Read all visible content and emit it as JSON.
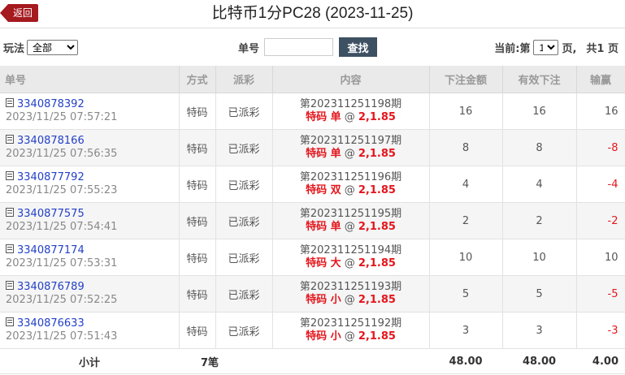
{
  "header": {
    "back_label": "返回",
    "title": "比特币1分PC28 (2023-11-25)"
  },
  "filters": {
    "play_label": "玩法",
    "play_value": "全部",
    "order_label": "单号",
    "order_value": "",
    "search_label": "查找",
    "current_label": "当前:第",
    "page_value": "1",
    "page_unit": "页,",
    "total_pages": "共1 页"
  },
  "table": {
    "columns": [
      "单号",
      "方式",
      "派彩",
      "内容",
      "下注金额",
      "有效下注",
      "输赢"
    ],
    "rows": [
      {
        "order_id": "3340878392",
        "time": "2023/11/25 07:57:21",
        "method": "特码",
        "status": "已派彩",
        "issue": "第202311251198期",
        "bet": "特码 单",
        "odds": "2,1.85",
        "amount": "16",
        "valid": "16",
        "winloss": "16"
      },
      {
        "order_id": "3340878166",
        "time": "2023/11/25 07:56:35",
        "method": "特码",
        "status": "已派彩",
        "issue": "第202311251197期",
        "bet": "特码 单",
        "odds": "2,1.85",
        "amount": "8",
        "valid": "8",
        "winloss": "-8"
      },
      {
        "order_id": "3340877792",
        "time": "2023/11/25 07:55:23",
        "method": "特码",
        "status": "已派彩",
        "issue": "第202311251196期",
        "bet": "特码 双",
        "odds": "2,1.85",
        "amount": "4",
        "valid": "4",
        "winloss": "-4"
      },
      {
        "order_id": "3340877575",
        "time": "2023/11/25 07:54:41",
        "method": "特码",
        "status": "已派彩",
        "issue": "第202311251195期",
        "bet": "特码 单",
        "odds": "2,1.85",
        "amount": "2",
        "valid": "2",
        "winloss": "-2"
      },
      {
        "order_id": "3340877174",
        "time": "2023/11/25 07:53:31",
        "method": "特码",
        "status": "已派彩",
        "issue": "第202311251194期",
        "bet": "特码 大",
        "odds": "2,1.85",
        "amount": "10",
        "valid": "10",
        "winloss": "10"
      },
      {
        "order_id": "3340876789",
        "time": "2023/11/25 07:52:25",
        "method": "特码",
        "status": "已派彩",
        "issue": "第202311251193期",
        "bet": "特码 小",
        "odds": "2,1.85",
        "amount": "5",
        "valid": "5",
        "winloss": "-5"
      },
      {
        "order_id": "3340876633",
        "time": "2023/11/25 07:51:43",
        "method": "特码",
        "status": "已派彩",
        "issue": "第202311251192期",
        "bet": "特码 小",
        "odds": "2,1.85",
        "amount": "3",
        "valid": "3",
        "winloss": "-3"
      }
    ],
    "summary": {
      "label": "小计",
      "count": "7笔",
      "amount": "48.00",
      "valid": "48.00",
      "winloss": "4.00"
    }
  },
  "colors": {
    "accent_red": "#e4161c",
    "back_button": "#a51a1f",
    "search_button": "#3e5162",
    "link_blue": "#2340c8"
  },
  "icons": {
    "order_icon": "document-icon"
  }
}
